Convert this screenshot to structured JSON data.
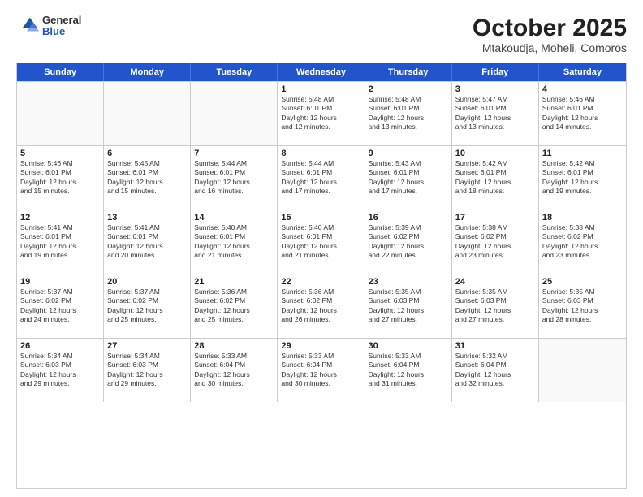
{
  "header": {
    "logo": {
      "general": "General",
      "blue": "Blue"
    },
    "title": "October 2025",
    "subtitle": "Mtakoudja, Moheli, Comoros"
  },
  "days_of_week": [
    "Sunday",
    "Monday",
    "Tuesday",
    "Wednesday",
    "Thursday",
    "Friday",
    "Saturday"
  ],
  "weeks": [
    [
      {
        "day": null,
        "info": null
      },
      {
        "day": null,
        "info": null
      },
      {
        "day": null,
        "info": null
      },
      {
        "day": "1",
        "info": "Sunrise: 5:48 AM\nSunset: 6:01 PM\nDaylight: 12 hours\nand 12 minutes."
      },
      {
        "day": "2",
        "info": "Sunrise: 5:48 AM\nSunset: 6:01 PM\nDaylight: 12 hours\nand 13 minutes."
      },
      {
        "day": "3",
        "info": "Sunrise: 5:47 AM\nSunset: 6:01 PM\nDaylight: 12 hours\nand 13 minutes."
      },
      {
        "day": "4",
        "info": "Sunrise: 5:46 AM\nSunset: 6:01 PM\nDaylight: 12 hours\nand 14 minutes."
      }
    ],
    [
      {
        "day": "5",
        "info": "Sunrise: 5:46 AM\nSunset: 6:01 PM\nDaylight: 12 hours\nand 15 minutes."
      },
      {
        "day": "6",
        "info": "Sunrise: 5:45 AM\nSunset: 6:01 PM\nDaylight: 12 hours\nand 15 minutes."
      },
      {
        "day": "7",
        "info": "Sunrise: 5:44 AM\nSunset: 6:01 PM\nDaylight: 12 hours\nand 16 minutes."
      },
      {
        "day": "8",
        "info": "Sunrise: 5:44 AM\nSunset: 6:01 PM\nDaylight: 12 hours\nand 17 minutes."
      },
      {
        "day": "9",
        "info": "Sunrise: 5:43 AM\nSunset: 6:01 PM\nDaylight: 12 hours\nand 17 minutes."
      },
      {
        "day": "10",
        "info": "Sunrise: 5:42 AM\nSunset: 6:01 PM\nDaylight: 12 hours\nand 18 minutes."
      },
      {
        "day": "11",
        "info": "Sunrise: 5:42 AM\nSunset: 6:01 PM\nDaylight: 12 hours\nand 19 minutes."
      }
    ],
    [
      {
        "day": "12",
        "info": "Sunrise: 5:41 AM\nSunset: 6:01 PM\nDaylight: 12 hours\nand 19 minutes."
      },
      {
        "day": "13",
        "info": "Sunrise: 5:41 AM\nSunset: 6:01 PM\nDaylight: 12 hours\nand 20 minutes."
      },
      {
        "day": "14",
        "info": "Sunrise: 5:40 AM\nSunset: 6:01 PM\nDaylight: 12 hours\nand 21 minutes."
      },
      {
        "day": "15",
        "info": "Sunrise: 5:40 AM\nSunset: 6:01 PM\nDaylight: 12 hours\nand 21 minutes."
      },
      {
        "day": "16",
        "info": "Sunrise: 5:39 AM\nSunset: 6:02 PM\nDaylight: 12 hours\nand 22 minutes."
      },
      {
        "day": "17",
        "info": "Sunrise: 5:38 AM\nSunset: 6:02 PM\nDaylight: 12 hours\nand 23 minutes."
      },
      {
        "day": "18",
        "info": "Sunrise: 5:38 AM\nSunset: 6:02 PM\nDaylight: 12 hours\nand 23 minutes."
      }
    ],
    [
      {
        "day": "19",
        "info": "Sunrise: 5:37 AM\nSunset: 6:02 PM\nDaylight: 12 hours\nand 24 minutes."
      },
      {
        "day": "20",
        "info": "Sunrise: 5:37 AM\nSunset: 6:02 PM\nDaylight: 12 hours\nand 25 minutes."
      },
      {
        "day": "21",
        "info": "Sunrise: 5:36 AM\nSunset: 6:02 PM\nDaylight: 12 hours\nand 25 minutes."
      },
      {
        "day": "22",
        "info": "Sunrise: 5:36 AM\nSunset: 6:02 PM\nDaylight: 12 hours\nand 26 minutes."
      },
      {
        "day": "23",
        "info": "Sunrise: 5:35 AM\nSunset: 6:03 PM\nDaylight: 12 hours\nand 27 minutes."
      },
      {
        "day": "24",
        "info": "Sunrise: 5:35 AM\nSunset: 6:03 PM\nDaylight: 12 hours\nand 27 minutes."
      },
      {
        "day": "25",
        "info": "Sunrise: 5:35 AM\nSunset: 6:03 PM\nDaylight: 12 hours\nand 28 minutes."
      }
    ],
    [
      {
        "day": "26",
        "info": "Sunrise: 5:34 AM\nSunset: 6:03 PM\nDaylight: 12 hours\nand 29 minutes."
      },
      {
        "day": "27",
        "info": "Sunrise: 5:34 AM\nSunset: 6:03 PM\nDaylight: 12 hours\nand 29 minutes."
      },
      {
        "day": "28",
        "info": "Sunrise: 5:33 AM\nSunset: 6:04 PM\nDaylight: 12 hours\nand 30 minutes."
      },
      {
        "day": "29",
        "info": "Sunrise: 5:33 AM\nSunset: 6:04 PM\nDaylight: 12 hours\nand 30 minutes."
      },
      {
        "day": "30",
        "info": "Sunrise: 5:33 AM\nSunset: 6:04 PM\nDaylight: 12 hours\nand 31 minutes."
      },
      {
        "day": "31",
        "info": "Sunrise: 5:32 AM\nSunset: 6:04 PM\nDaylight: 12 hours\nand 32 minutes."
      },
      {
        "day": null,
        "info": null
      }
    ]
  ]
}
